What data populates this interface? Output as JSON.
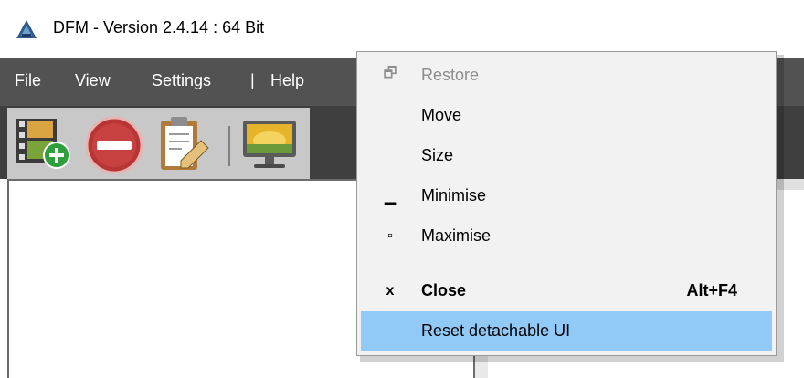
{
  "window": {
    "title": "DFM - Version 2.4.14 : 64 Bit",
    "icon": "triangle-app-icon"
  },
  "menubar": {
    "items": [
      {
        "label": "File"
      },
      {
        "label": "View"
      },
      {
        "label": "Settings"
      },
      {
        "label": "|"
      },
      {
        "label": "Help"
      }
    ]
  },
  "toolbar": {
    "buttons": [
      {
        "icon": "add-video-icon"
      },
      {
        "icon": "remove-icon"
      },
      {
        "icon": "clipboard-edit-icon"
      },
      {
        "icon": "monitor-icon"
      }
    ]
  },
  "context_menu": {
    "items": [
      {
        "label": "Restore",
        "icon": "restore-icon",
        "icon_glyph": "🗗",
        "enabled": false
      },
      {
        "label": "Move",
        "icon": "",
        "icon_glyph": ""
      },
      {
        "label": "Size",
        "icon": "",
        "icon_glyph": ""
      },
      {
        "label": "Minimise",
        "icon": "minimise-icon",
        "icon_glyph": "▁"
      },
      {
        "label": "Maximise",
        "icon": "maximise-icon",
        "icon_glyph": "▫"
      },
      {
        "label": "Close",
        "icon": "close-icon",
        "icon_glyph": "x",
        "shortcut": "Alt+F4",
        "bold": true
      },
      {
        "label": "Reset detachable UI",
        "icon": "",
        "icon_glyph": "",
        "highlighted": true
      }
    ]
  },
  "colors": {
    "menubar_bg": "#525252",
    "toolbar_bg": "#3f3f3f",
    "toolbar_panel": "#c8c8c8",
    "menu_bg": "#f2f2f2",
    "highlight": "#91c9f7"
  }
}
